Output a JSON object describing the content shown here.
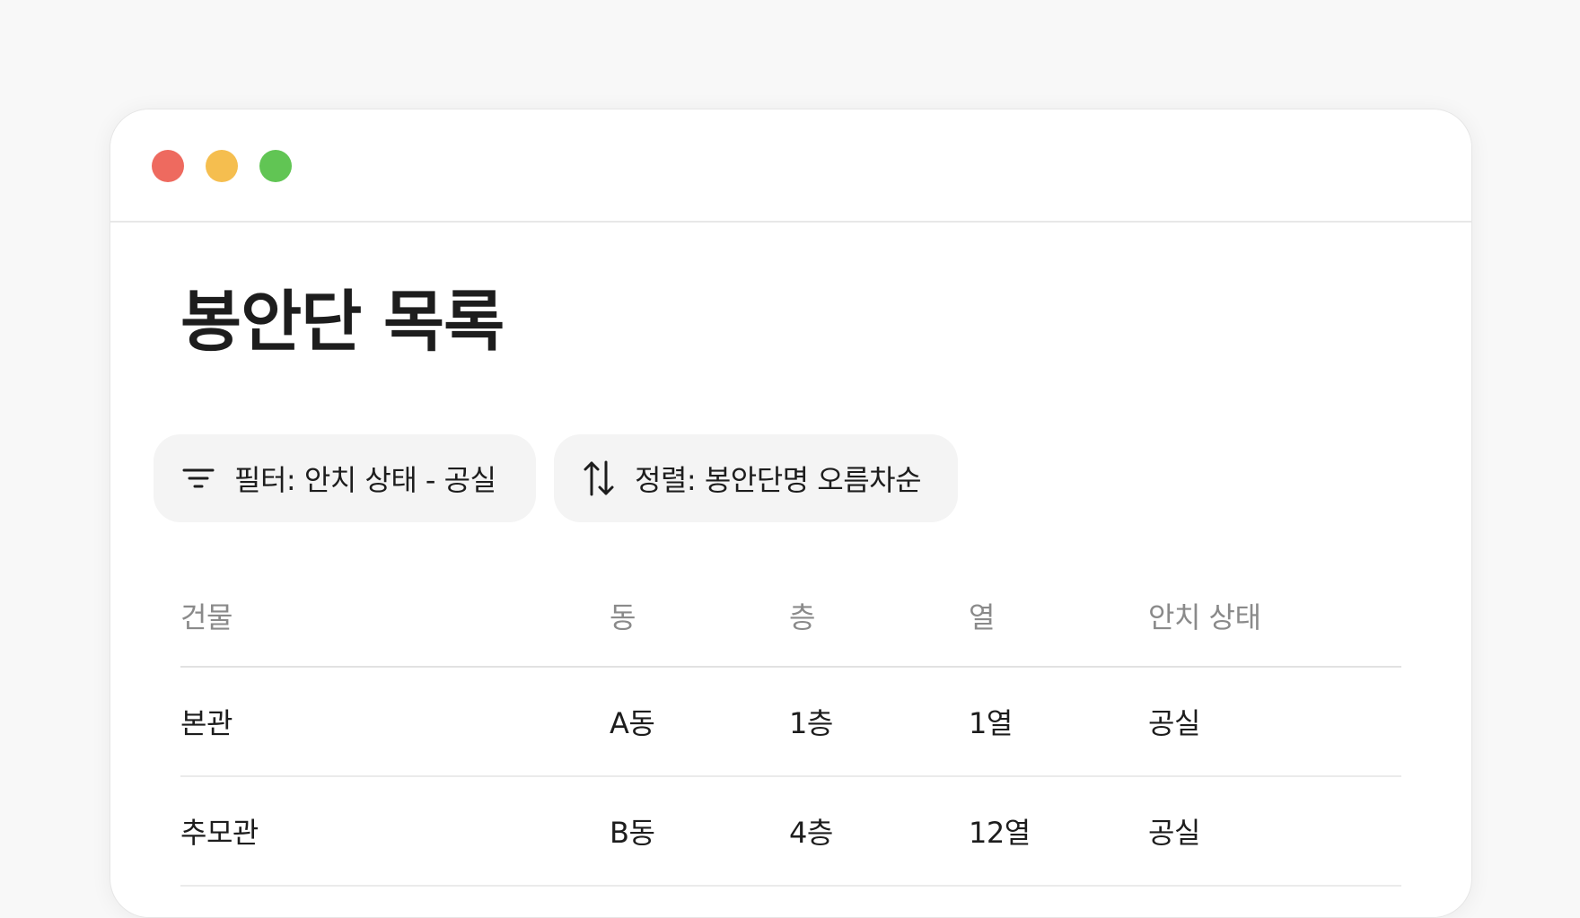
{
  "window": {
    "controls": {
      "close_color": "#ee6a5f",
      "minimize_color": "#f5be4f",
      "maximize_color": "#61c554"
    }
  },
  "page": {
    "title": "봉안단 목록"
  },
  "toolbar": {
    "filter": {
      "icon": "filter-icon",
      "label": "필터: 안치 상태 - 공실"
    },
    "sort": {
      "icon": "sort-icon",
      "label": "정렬: 봉안단명 오름차순"
    }
  },
  "table": {
    "columns": [
      "건물",
      "동",
      "층",
      "열",
      "안치 상태"
    ],
    "rows": [
      [
        "본관",
        "A동",
        "1층",
        "1열",
        "공실"
      ],
      [
        "추모관",
        "B동",
        "4층",
        "12열",
        "공실"
      ]
    ]
  }
}
